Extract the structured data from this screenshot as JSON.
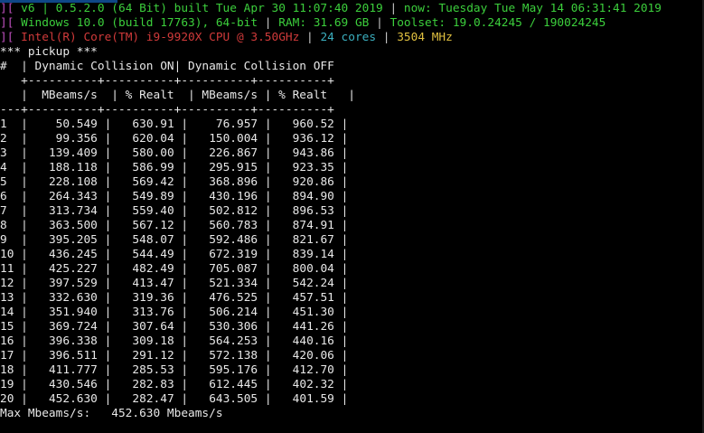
{
  "header": {
    "line1": {
      "bracket": "][",
      "version": " v6 | 0.5.2.0 (64 Bit) built Tue Apr 30 11:07:40 2019 ",
      "sep": "|",
      "now": " now: Tuesday Tue May 14 06:31:41 2019"
    },
    "line2": {
      "bracket": "][",
      "os": " Windows 10.0 (build 17763), 64-bit ",
      "sep1": "|",
      "ram": " RAM: 31.69 GB ",
      "sep2": "|",
      "toolset": " Toolset: 19.0.24245 / 190024245"
    },
    "line3": {
      "bracket": "][",
      "cpu": " Intel(R) Core(TM) i9-9920X CPU @ 3.50GHz ",
      "sep1": "|",
      "cores": " 24 cores ",
      "sep2": "|",
      "mhz": " 3504 MHz"
    }
  },
  "benchmark": {
    "title": "*** pickup ***",
    "header_row": "#  | Dynamic Collision ON| Dynamic Collision OFF",
    "divider_top": "   +----------+----------+----------+----------+",
    "col_header_row": "   |  MBeams/s  | % Realt  | MBeams/s | % Realt   |",
    "divider_mid": "---+----------+----------+----------+----------+",
    "columns": [
      "#",
      "MBeams/s",
      "% Realt",
      "MBeams/s",
      "% Realt"
    ],
    "rows": [
      [
        "1",
        "50.549",
        "630.91",
        "76.957",
        "960.52"
      ],
      [
        "2",
        "99.356",
        "620.04",
        "150.004",
        "936.12"
      ],
      [
        "3",
        "139.409",
        "580.00",
        "226.867",
        "943.86"
      ],
      [
        "4",
        "188.118",
        "586.99",
        "295.915",
        "923.35"
      ],
      [
        "5",
        "228.108",
        "569.42",
        "368.896",
        "920.86"
      ],
      [
        "6",
        "264.343",
        "549.89",
        "430.196",
        "894.90"
      ],
      [
        "7",
        "313.734",
        "559.40",
        "502.812",
        "896.53"
      ],
      [
        "8",
        "363.500",
        "567.12",
        "560.783",
        "874.91"
      ],
      [
        "9",
        "395.205",
        "548.07",
        "592.486",
        "821.67"
      ],
      [
        "10",
        "436.245",
        "544.49",
        "672.319",
        "839.14"
      ],
      [
        "11",
        "425.227",
        "482.49",
        "705.087",
        "800.04"
      ],
      [
        "12",
        "397.529",
        "413.47",
        "521.334",
        "542.24"
      ],
      [
        "13",
        "332.630",
        "319.36",
        "476.525",
        "457.51"
      ],
      [
        "14",
        "351.940",
        "313.76",
        "506.214",
        "451.30"
      ],
      [
        "15",
        "369.724",
        "307.64",
        "530.306",
        "441.26"
      ],
      [
        "16",
        "396.338",
        "309.18",
        "564.253",
        "440.16"
      ],
      [
        "17",
        "396.511",
        "291.12",
        "572.138",
        "420.06"
      ],
      [
        "18",
        "411.777",
        "285.53",
        "595.176",
        "412.70"
      ],
      [
        "19",
        "430.546",
        "282.83",
        "612.445",
        "402.32"
      ],
      [
        "20",
        "452.630",
        "282.47",
        "643.505",
        "401.59"
      ]
    ],
    "footer": "Max Mbeams/s:   452.630 Mbeams/s"
  },
  "colors": {
    "background": "#000000",
    "bracket": "#c050c0",
    "green": "#3ccf3c",
    "red": "#d03a3a",
    "cyan": "#3bb0c0",
    "yellow": "#e0c040",
    "text": "#cccccc"
  }
}
